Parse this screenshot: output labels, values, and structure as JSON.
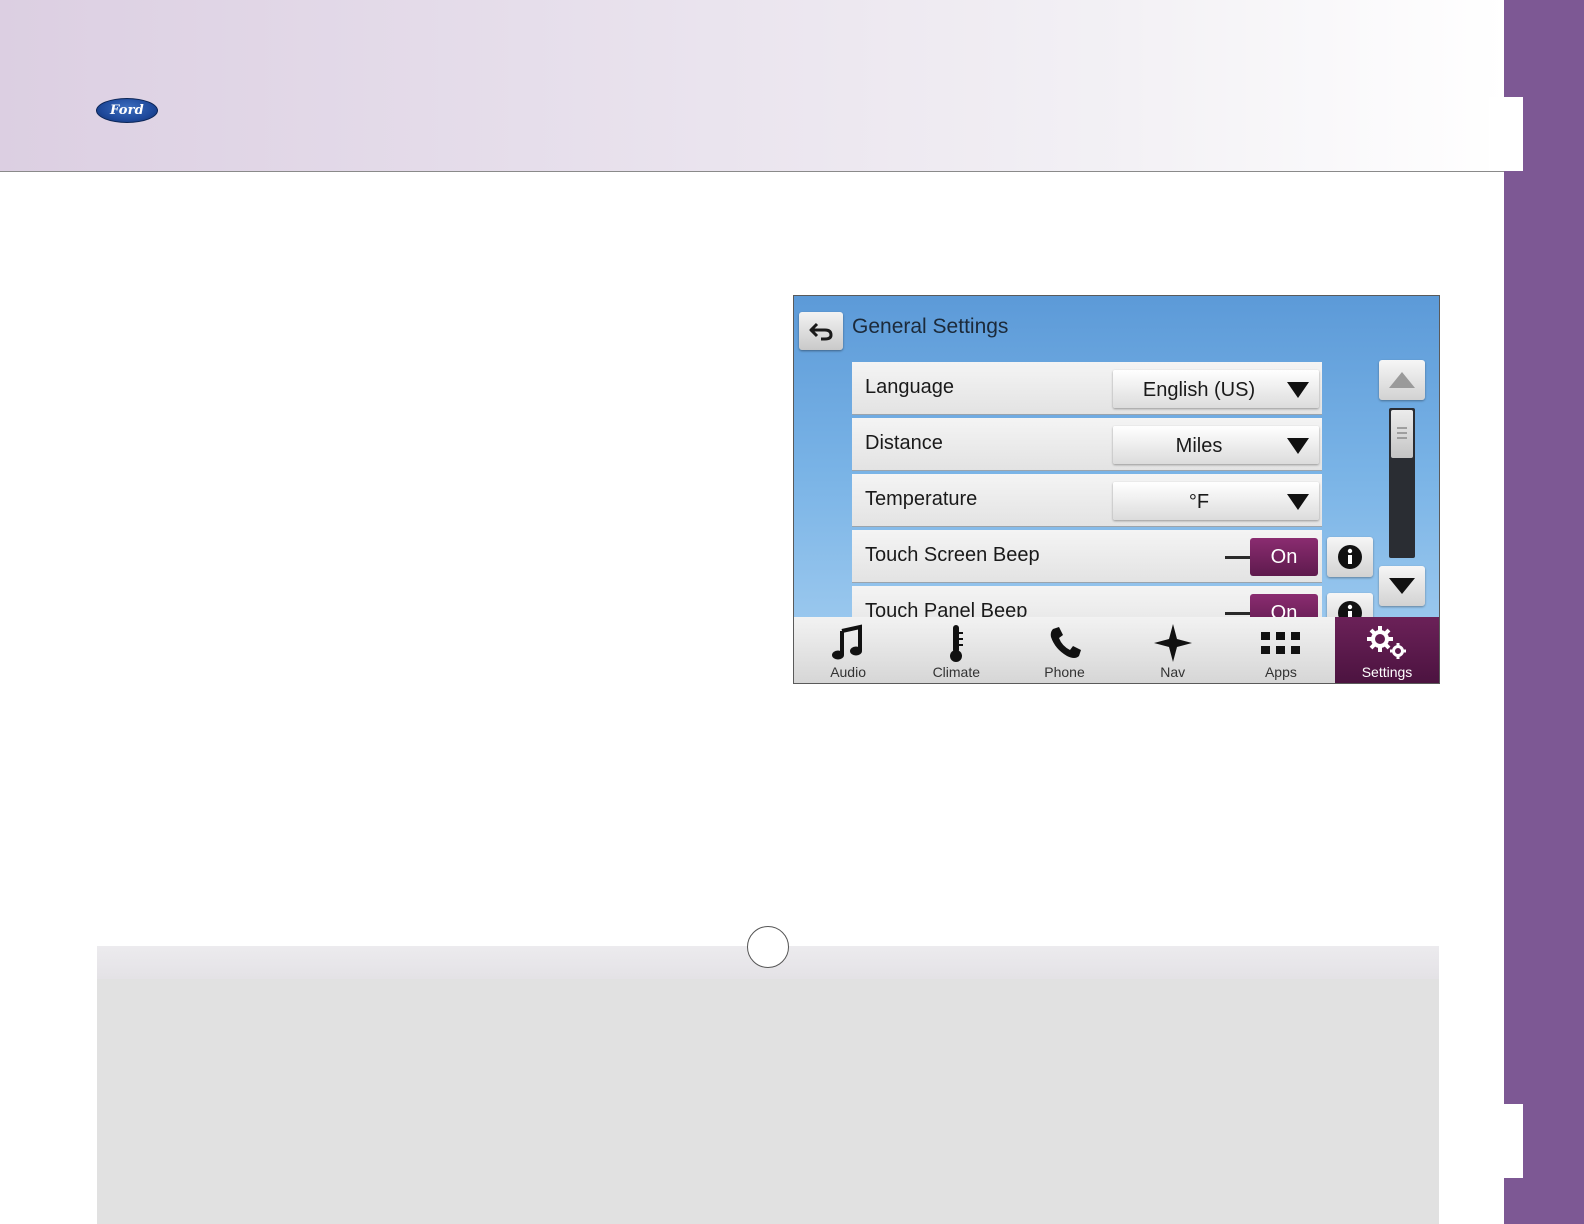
{
  "brand": {
    "logo_text": "Ford"
  },
  "colors": {
    "accent": "#7d5894",
    "screen_blue": "#79b3e6",
    "toggle_on": "#6b2158"
  },
  "screen": {
    "title": "General Settings",
    "back_icon": "back-arrow-icon",
    "rows": [
      {
        "label": "Language",
        "type": "dropdown",
        "value": "English (US)"
      },
      {
        "label": "Distance",
        "type": "dropdown",
        "value": "Miles"
      },
      {
        "label": "Temperature",
        "type": "dropdown",
        "value": "°F"
      },
      {
        "label": "Touch Screen Beep",
        "type": "toggle",
        "value": "On"
      },
      {
        "label": "Touch Panel Beep",
        "type": "toggle",
        "value": "On"
      }
    ],
    "nav": [
      {
        "label": "Audio",
        "icon": "music-note-icon"
      },
      {
        "label": "Climate",
        "icon": "thermometer-icon"
      },
      {
        "label": "Phone",
        "icon": "phone-icon"
      },
      {
        "label": "Nav",
        "icon": "compass-star-icon"
      },
      {
        "label": "Apps",
        "icon": "apps-grid-icon"
      },
      {
        "label": "Settings",
        "icon": "gears-icon",
        "active": true
      }
    ]
  }
}
